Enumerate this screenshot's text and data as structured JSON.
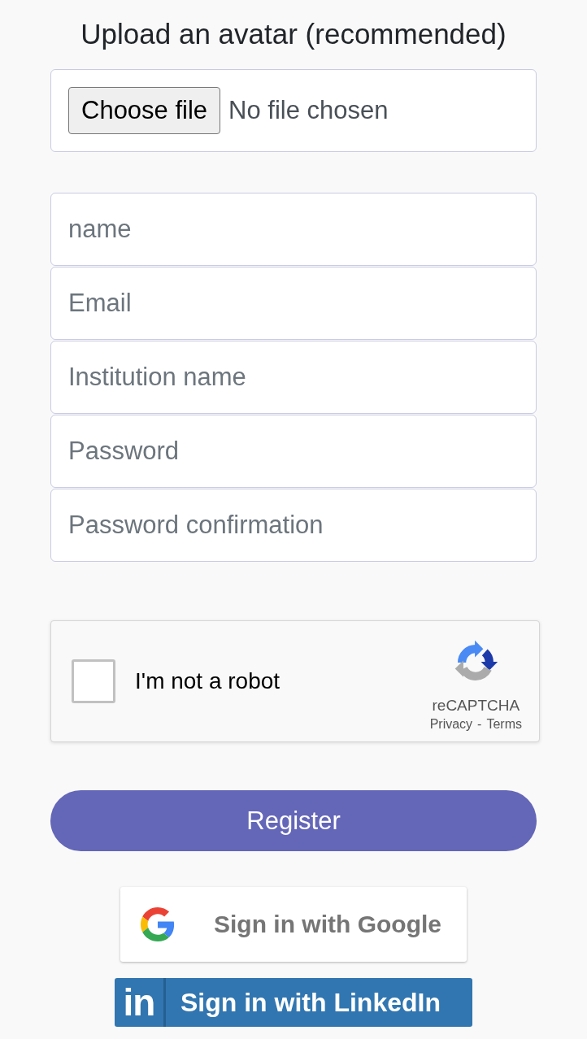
{
  "heading": "Upload an avatar (recommended)",
  "avatar_upload": {
    "button": "Choose file",
    "status": "No file chosen"
  },
  "fields": [
    {
      "placeholder": "name"
    },
    {
      "placeholder": "Email"
    },
    {
      "placeholder": "Institution name"
    },
    {
      "placeholder": "Password"
    },
    {
      "placeholder": "Password confirmation"
    }
  ],
  "captcha": {
    "label": "I'm not a robot",
    "checked": false,
    "brand": "reCAPTCHA",
    "links": [
      "Privacy",
      "Terms"
    ],
    "separator": "-"
  },
  "register_button": "Register",
  "social_buttons": [
    {
      "kind": "google",
      "label": "Sign in with Google"
    },
    {
      "kind": "linkedin",
      "logo_text": "in",
      "label": "Sign in with LinkedIn"
    }
  ]
}
